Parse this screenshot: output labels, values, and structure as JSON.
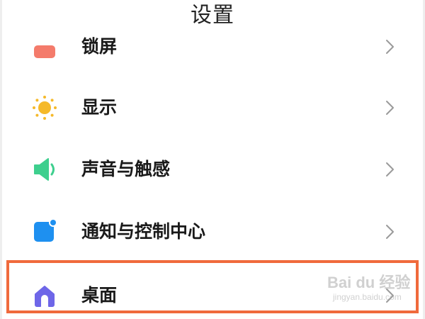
{
  "header": {
    "title": "设置"
  },
  "settings": {
    "items": [
      {
        "label": "锁屏",
        "icon": "lock-screen-icon",
        "color": "#f47b6b"
      },
      {
        "label": "显示",
        "icon": "sun-icon",
        "color": "#f5b92a"
      },
      {
        "label": "声音与触感",
        "icon": "speaker-icon",
        "color": "#3ecf8e"
      },
      {
        "label": "通知与控制中心",
        "icon": "notification-icon",
        "color": "#1e90f0"
      },
      {
        "label": "桌面",
        "icon": "home-icon",
        "color": "#6e66e8"
      }
    ],
    "highlighted_item": "桌面",
    "highlight_color": "#f06a3c"
  },
  "watermark": {
    "line1": "Bai du 经验",
    "line2": "jingyan.baidu.com"
  }
}
